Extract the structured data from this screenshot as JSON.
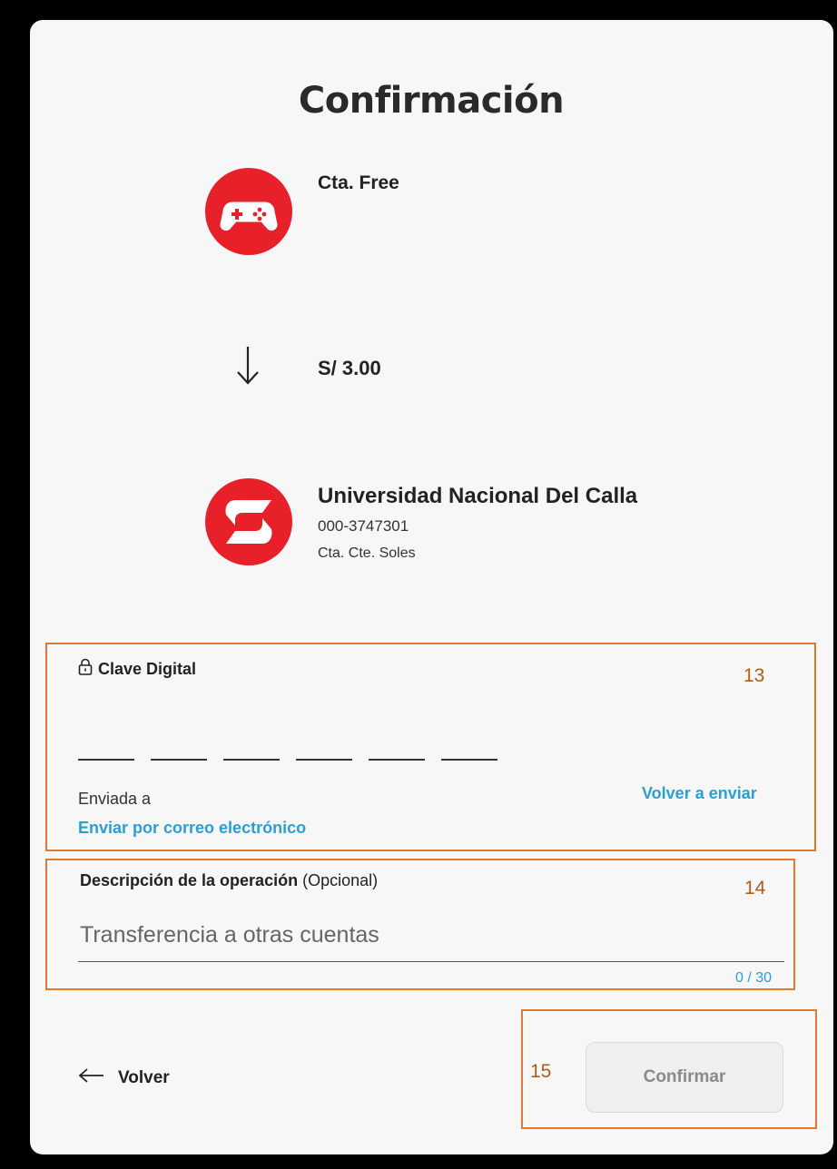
{
  "page": {
    "title": "Confirmación"
  },
  "origin": {
    "icon": "gamepad-icon",
    "name": "Cta. Free"
  },
  "transfer": {
    "arrow_icon": "arrow-down-icon",
    "amount": "S/ 3.00"
  },
  "destination": {
    "icon": "bank-logo-icon",
    "name": "Universidad Nacional Del Calla",
    "number": "000-3747301",
    "type": "Cta. Cte. Soles"
  },
  "clave": {
    "icon": "lock-icon",
    "label": "Clave Digital",
    "digit_count": 6,
    "sent_to": "Enviada a",
    "resend": "Volver a enviar",
    "email_link": "Enviar por correo electrónico"
  },
  "description": {
    "label": "Descripción de la operación",
    "optional": " (Opcional)",
    "placeholder": "Transferencia a otras cuentas",
    "counter": "0 / 30"
  },
  "footer": {
    "back_icon": "arrow-left-icon",
    "back_label": "Volver",
    "confirm_label": "Confirmar"
  },
  "annotations": [
    "13",
    "14",
    "15"
  ],
  "colors": {
    "brand_red": "#e8202a",
    "link_blue": "#2a9fd6",
    "annotation_orange": "#e07a2e"
  }
}
